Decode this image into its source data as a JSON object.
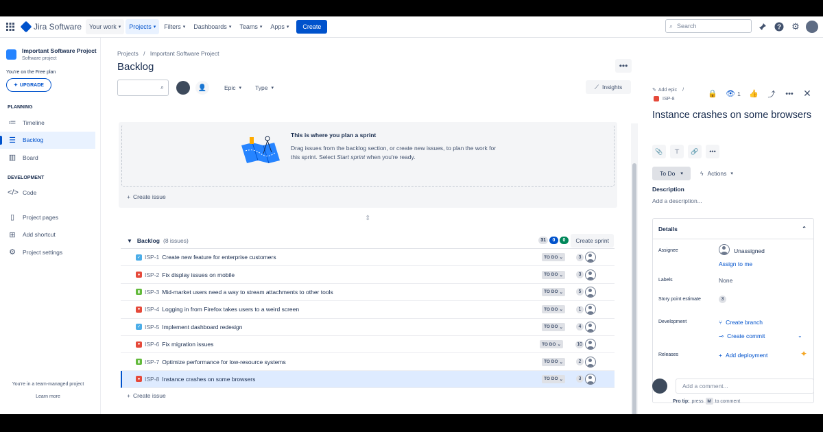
{
  "nav": {
    "logo": "Jira Software",
    "items": [
      {
        "label": "Your work"
      },
      {
        "label": "Projects"
      },
      {
        "label": "Filters"
      },
      {
        "label": "Dashboards"
      },
      {
        "label": "Teams"
      },
      {
        "label": "Apps"
      }
    ],
    "create": "Create",
    "search_placeholder": "Search"
  },
  "sidebar": {
    "project_name": "Important Software Project",
    "project_type": "Software project",
    "free_plan": "You're on the Free plan",
    "upgrade": "UPGRADE",
    "planning_heading": "PLANNING",
    "planning_items": [
      {
        "label": "Timeline"
      },
      {
        "label": "Backlog"
      },
      {
        "label": "Board"
      }
    ],
    "development_heading": "DEVELOPMENT",
    "development_items": [
      {
        "label": "Code"
      }
    ],
    "other_items": [
      {
        "label": "Project pages"
      },
      {
        "label": "Add shortcut"
      },
      {
        "label": "Project settings"
      }
    ],
    "team_managed": "You're in a team-managed project",
    "learn_more": "Learn more"
  },
  "main": {
    "breadcrumb": [
      "Projects",
      "Important Software Project"
    ],
    "breadcrumb_sep": "/",
    "title": "Backlog",
    "filters": {
      "epic": "Epic",
      "type": "Type"
    },
    "insights": "Insights",
    "sprint": {
      "title": "This is where you plan a sprint",
      "desc_part1": "Drag issues from the backlog section, or create new issues, to plan the work for this sprint. Select ",
      "desc_em": "Start sprint",
      "desc_part2": " when you're ready.",
      "create_issue": "Create issue"
    },
    "backlog": {
      "title": "Backlog",
      "count": "(8 issues)",
      "pill_todo": "31",
      "pill_inprogress": "0",
      "pill_done": "0",
      "create_sprint": "Create sprint",
      "create_issue": "Create issue",
      "issues": [
        {
          "type": "task",
          "key": "ISP-1",
          "summary": "Create new feature for enterprise customers",
          "status": "TO DO",
          "points": "3"
        },
        {
          "type": "bug",
          "key": "ISP-2",
          "summary": "Fix display issues on mobile",
          "status": "TO DO",
          "points": "3"
        },
        {
          "type": "story",
          "key": "ISP-3",
          "summary": "Mid-market users need a way to stream attachments to other tools",
          "status": "TO DO",
          "points": "5"
        },
        {
          "type": "bug",
          "key": "ISP-4",
          "summary": "Logging in from Firefox takes users to a weird screen",
          "status": "TO DO",
          "points": "1"
        },
        {
          "type": "task",
          "key": "ISP-5",
          "summary": "Implement dashboard redesign",
          "status": "TO DO",
          "points": "4"
        },
        {
          "type": "bug",
          "key": "ISP-6",
          "summary": "Fix migration issues",
          "status": "TO DO",
          "points": "10"
        },
        {
          "type": "story",
          "key": "ISP-7",
          "summary": "Optimize performance for low-resource systems",
          "status": "TO DO",
          "points": "2"
        },
        {
          "type": "bug",
          "key": "ISP-8",
          "summary": "Instance crashes on some browsers",
          "status": "TO DO",
          "points": "3"
        }
      ]
    }
  },
  "detail": {
    "add_epic": "Add epic",
    "key": "ISP-8",
    "watch_count": "1",
    "title": "Instance crashes on some browsers",
    "status": "To Do",
    "actions": "Actions",
    "description_label": "Description",
    "description_placeholder": "Add a description...",
    "details_label": "Details",
    "assignee_label": "Assignee",
    "assignee_value": "Unassigned",
    "assign_to_me": "Assign to me",
    "labels_label": "Labels",
    "labels_value": "None",
    "story_points_label": "Story point estimate",
    "story_points_value": "3",
    "development_label": "Development",
    "create_branch": "Create branch",
    "create_commit": "Create commit",
    "releases_label": "Releases",
    "add_deployment": "Add deployment",
    "comment_placeholder": "Add a comment...",
    "pro_tip_bold": "Pro tip:",
    "pro_tip_press": "press",
    "pro_tip_key": "M",
    "pro_tip_rest": "to comment"
  },
  "colors": {
    "accent": "#0052cc",
    "bug": "#e5493a",
    "story": "#63ba3c",
    "task": "#4bade8"
  }
}
